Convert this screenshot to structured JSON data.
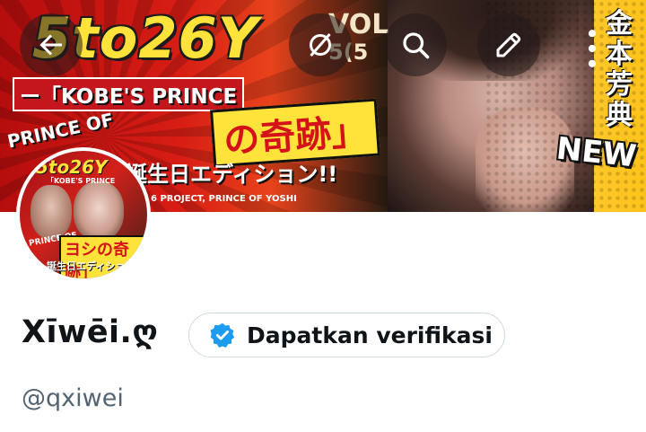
{
  "banner": {
    "title": "5to26Y",
    "vol_label": "VOL",
    "vol_number": "5(5",
    "subtitle": "ー「KOBE'S PRINCE",
    "prince_of": "PRINCE OF",
    "kiseki": "の奇跡」",
    "edition": "誕生日エディション!!",
    "credit": "6 PROJECT, PRINCE OF YOSHI",
    "new_badge": "NEW",
    "vertical_text": "金本芳典"
  },
  "avatar": {
    "title": "5to26Y",
    "subtitle": "「KOBE'S PRINCE",
    "prince_of": "PRINCE OF",
    "kiseki": "ヨシの奇跡」",
    "edition": "誕生日エディショ"
  },
  "nav": {
    "back_icon": "arrow-left-icon",
    "hide_icon": "eye-slash-icon",
    "search_icon": "search-icon",
    "edit_icon": "pencil-icon",
    "more_icon": "more-vertical-icon"
  },
  "profile": {
    "display_name": "Xīwēi.ღ",
    "verify_label": "Dapatkan verifikasi",
    "handle": "@qxiwei"
  },
  "colors": {
    "verified_blue": "#1d9bf0",
    "text_primary": "#0f1419",
    "text_secondary": "#536471",
    "border": "#cfd9de"
  }
}
